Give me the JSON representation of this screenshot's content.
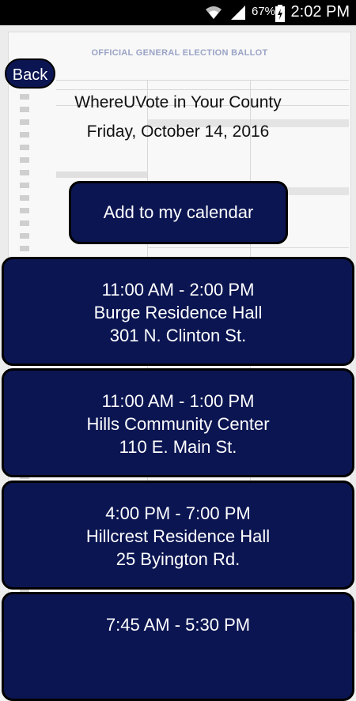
{
  "status_bar": {
    "battery_percent": "67%",
    "time": "2:02 PM",
    "icons": [
      "wifi-icon",
      "signal-icon",
      "battery-charging-icon"
    ]
  },
  "background": {
    "ballot_title": "OFFICIAL GENERAL ELECTION BALLOT"
  },
  "nav": {
    "back_label": "Back"
  },
  "header": {
    "title": "WhereUVote in Your County",
    "date": "Friday, October 14, 2016"
  },
  "actions": {
    "calendar_label": "Add to my calendar"
  },
  "locations": [
    {
      "time": "11:00 AM - 2:00 PM",
      "name": "Burge Residence Hall",
      "address": "301 N. Clinton St."
    },
    {
      "time": "11:00 AM - 1:00 PM",
      "name": "Hills Community Center",
      "address": "110 E. Main St."
    },
    {
      "time": "4:00 PM - 7:00 PM",
      "name": "Hillcrest Residence Hall",
      "address": "25 Byington Rd."
    },
    {
      "time": "7:45 AM - 5:30 PM",
      "name": "",
      "address": ""
    }
  ],
  "colors": {
    "button_fill": "#0b1552",
    "button_border": "#000000",
    "button_text": "#ffffff"
  }
}
